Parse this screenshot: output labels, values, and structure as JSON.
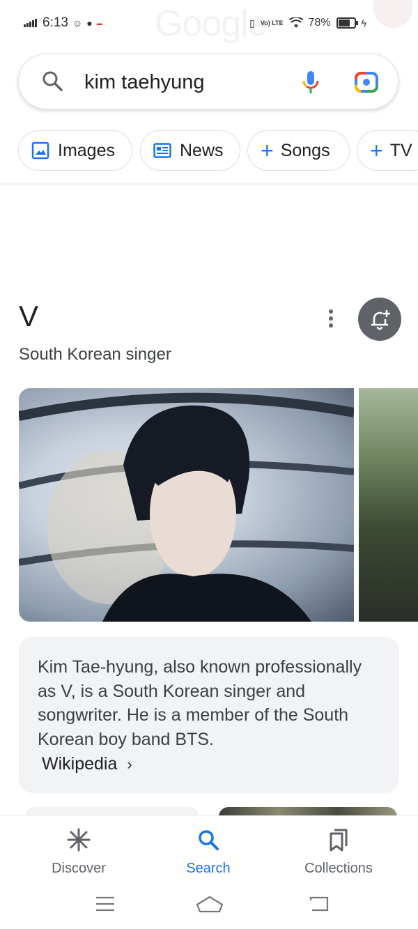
{
  "status_bar": {
    "time": "6:13",
    "battery_percent": "78%",
    "battery_level": 0.78,
    "network_label": "Vo) LTE",
    "watermark": "Google"
  },
  "search": {
    "query": "kim taehyung"
  },
  "chips": [
    {
      "label": "Images",
      "icon": "image-icon"
    },
    {
      "label": "News",
      "icon": "news-icon"
    },
    {
      "label": "Songs",
      "icon": "plus-icon"
    },
    {
      "label": "TV",
      "icon": "plus-icon"
    }
  ],
  "knowledge_panel": {
    "title": "V",
    "subtitle": "South Korean singer",
    "description": "Kim Tae-hyung, also known professionally as V, is a South Korean singer and songwriter. He is a member of the South Korean boy band BTS.",
    "source_link": "Wikipedia",
    "source_chevron": "›"
  },
  "bottom_nav": {
    "items": [
      {
        "label": "Discover",
        "icon": "discover-icon",
        "active": false
      },
      {
        "label": "Search",
        "icon": "search-icon",
        "active": true
      },
      {
        "label": "Collections",
        "icon": "collections-icon",
        "active": false
      }
    ]
  },
  "colors": {
    "accent_blue": "#1a73e8",
    "text_primary": "#202124",
    "text_secondary": "#5f6368",
    "card_bg": "#f1f3f4"
  }
}
